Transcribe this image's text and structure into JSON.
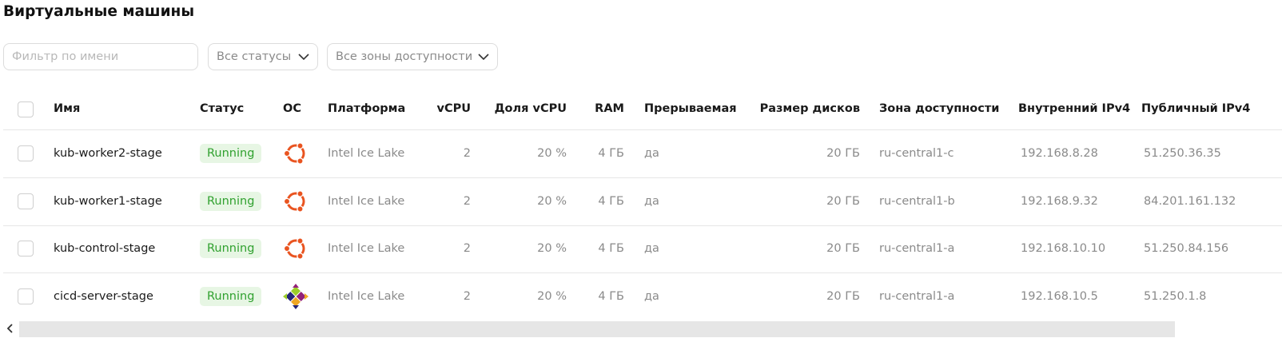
{
  "page": {
    "title": "Виртуальные машины"
  },
  "filters": {
    "name_placeholder": "Фильтр по имени",
    "status_select": "Все статусы",
    "zone_select": "Все зоны доступности"
  },
  "table": {
    "columns": {
      "name": "Имя",
      "status": "Статус",
      "os": "ОС",
      "platform": "Платформа",
      "vcpu": "vCPU",
      "vcpu_share": "Доля vCPU",
      "ram": "RAM",
      "preemptible": "Прерываемая",
      "disk_size": "Размер дисков",
      "zone": "Зона доступности",
      "internal_ipv4": "Внутренний IPv4",
      "public_ipv4": "Публичный IPv4"
    },
    "rows": [
      {
        "name": "kub-worker2-stage",
        "status": "Running",
        "os_icon": "ubuntu-icon",
        "platform": "Intel Ice Lake",
        "vcpu": "2",
        "vcpu_share": "20 %",
        "ram": "4 ГБ",
        "preemptible": "да",
        "disk_size": "20 ГБ",
        "zone": "ru-central1-c",
        "internal_ipv4": "192.168.8.28",
        "public_ipv4": "51.250.36.35"
      },
      {
        "name": "kub-worker1-stage",
        "status": "Running",
        "os_icon": "ubuntu-icon",
        "platform": "Intel Ice Lake",
        "vcpu": "2",
        "vcpu_share": "20 %",
        "ram": "4 ГБ",
        "preemptible": "да",
        "disk_size": "20 ГБ",
        "zone": "ru-central1-b",
        "internal_ipv4": "192.168.9.32",
        "public_ipv4": "84.201.161.132"
      },
      {
        "name": "kub-control-stage",
        "status": "Running",
        "os_icon": "ubuntu-icon",
        "platform": "Intel Ice Lake",
        "vcpu": "2",
        "vcpu_share": "20 %",
        "ram": "4 ГБ",
        "preemptible": "да",
        "disk_size": "20 ГБ",
        "zone": "ru-central1-a",
        "internal_ipv4": "192.168.10.10",
        "public_ipv4": "51.250.84.156"
      },
      {
        "name": "cicd-server-stage",
        "status": "Running",
        "os_icon": "centos-icon",
        "platform": "Intel Ice Lake",
        "vcpu": "2",
        "vcpu_share": "20 %",
        "ram": "4 ГБ",
        "preemptible": "да",
        "disk_size": "20 ГБ",
        "zone": "ru-central1-a",
        "internal_ipv4": "192.168.10.5",
        "public_ipv4": "51.250.1.8"
      }
    ]
  },
  "colors": {
    "running_text": "#30a12f",
    "running_bg": "#e7f6e4",
    "ubuntu_orange": "#e95420"
  }
}
